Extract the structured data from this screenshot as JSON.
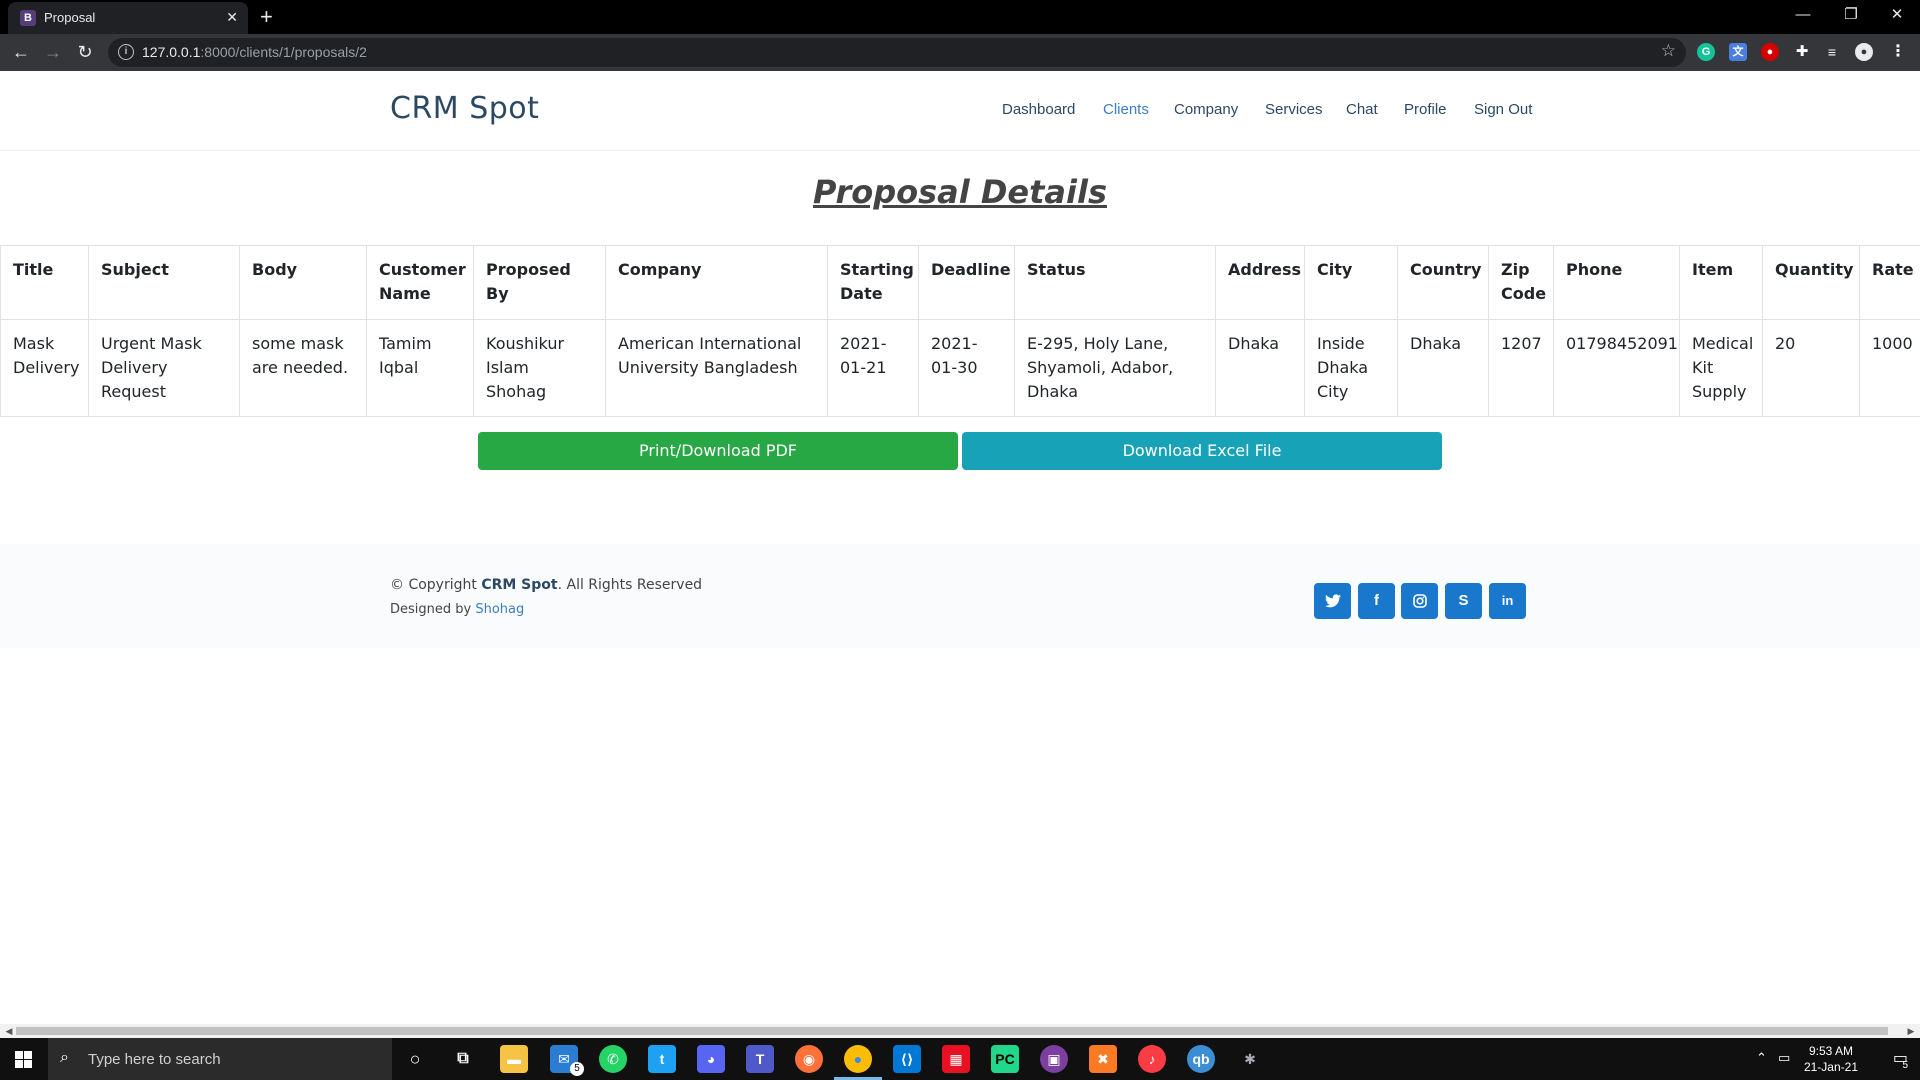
{
  "browser": {
    "tab_title": "Proposal",
    "tab_favicon_letter": "B",
    "url_host": "127.0.0.1",
    "url_rest": ":8000/clients/1/proposals/2"
  },
  "site": {
    "brand": "CRM Spot",
    "nav": [
      {
        "label": "Dashboard",
        "active": false
      },
      {
        "label": "Clients",
        "active": true
      },
      {
        "label": "Company",
        "active": false
      },
      {
        "label": "Services",
        "active": false
      },
      {
        "label": "Chat",
        "active": false
      },
      {
        "label": "Profile",
        "active": false
      },
      {
        "label": "Sign Out",
        "active": false
      }
    ]
  },
  "main": {
    "title": "Proposal Details",
    "table": {
      "headers": [
        "Title",
        "Subject",
        "Body",
        "Customer Name",
        "Proposed By",
        "Company",
        "Starting Date",
        "Deadline",
        "Status",
        "Address",
        "City",
        "Country",
        "Zip Code",
        "Phone",
        "Item",
        "Quantity",
        "Rate"
      ],
      "row": [
        "Mask Delivery",
        "Urgent Mask Delivery Request",
        "some mask are needed.",
        "Tamim Iqbal",
        "Koushikur Islam Shohag",
        "American International University Bangladesh",
        "2021-01-21",
        "2021-01-30",
        "E-295, Holy Lane, Shyamoli, Adabor, Dhaka",
        "Dhaka",
        "Inside Dhaka City",
        "Dhaka",
        "1207",
        "01798452091",
        "Medical Kit Supply",
        "20",
        "1000"
      ]
    },
    "buttons": {
      "pdf": "Print/Download PDF",
      "excel": "Download Excel File"
    }
  },
  "footer": {
    "copyright_prefix": "© Copyright ",
    "copyright_brand": "CRM Spot",
    "copyright_suffix": ". All Rights Reserved",
    "designed_prefix": "Designed by ",
    "designer": "Shohag",
    "social": [
      "twitter-icon",
      "facebook-icon",
      "instagram-icon",
      "skype-icon",
      "linkedin-icon"
    ]
  },
  "taskbar": {
    "search_placeholder": "Type here to search",
    "time": "9:53 AM",
    "date": "21-Jan-21",
    "mail_badge": "5",
    "notif_badge": "5"
  },
  "colors": {
    "brand": "#2c4964",
    "accent": "#3b7ec0",
    "pdf_button": "#28a745",
    "excel_button": "#17a2b8",
    "social": "#1977cc"
  }
}
